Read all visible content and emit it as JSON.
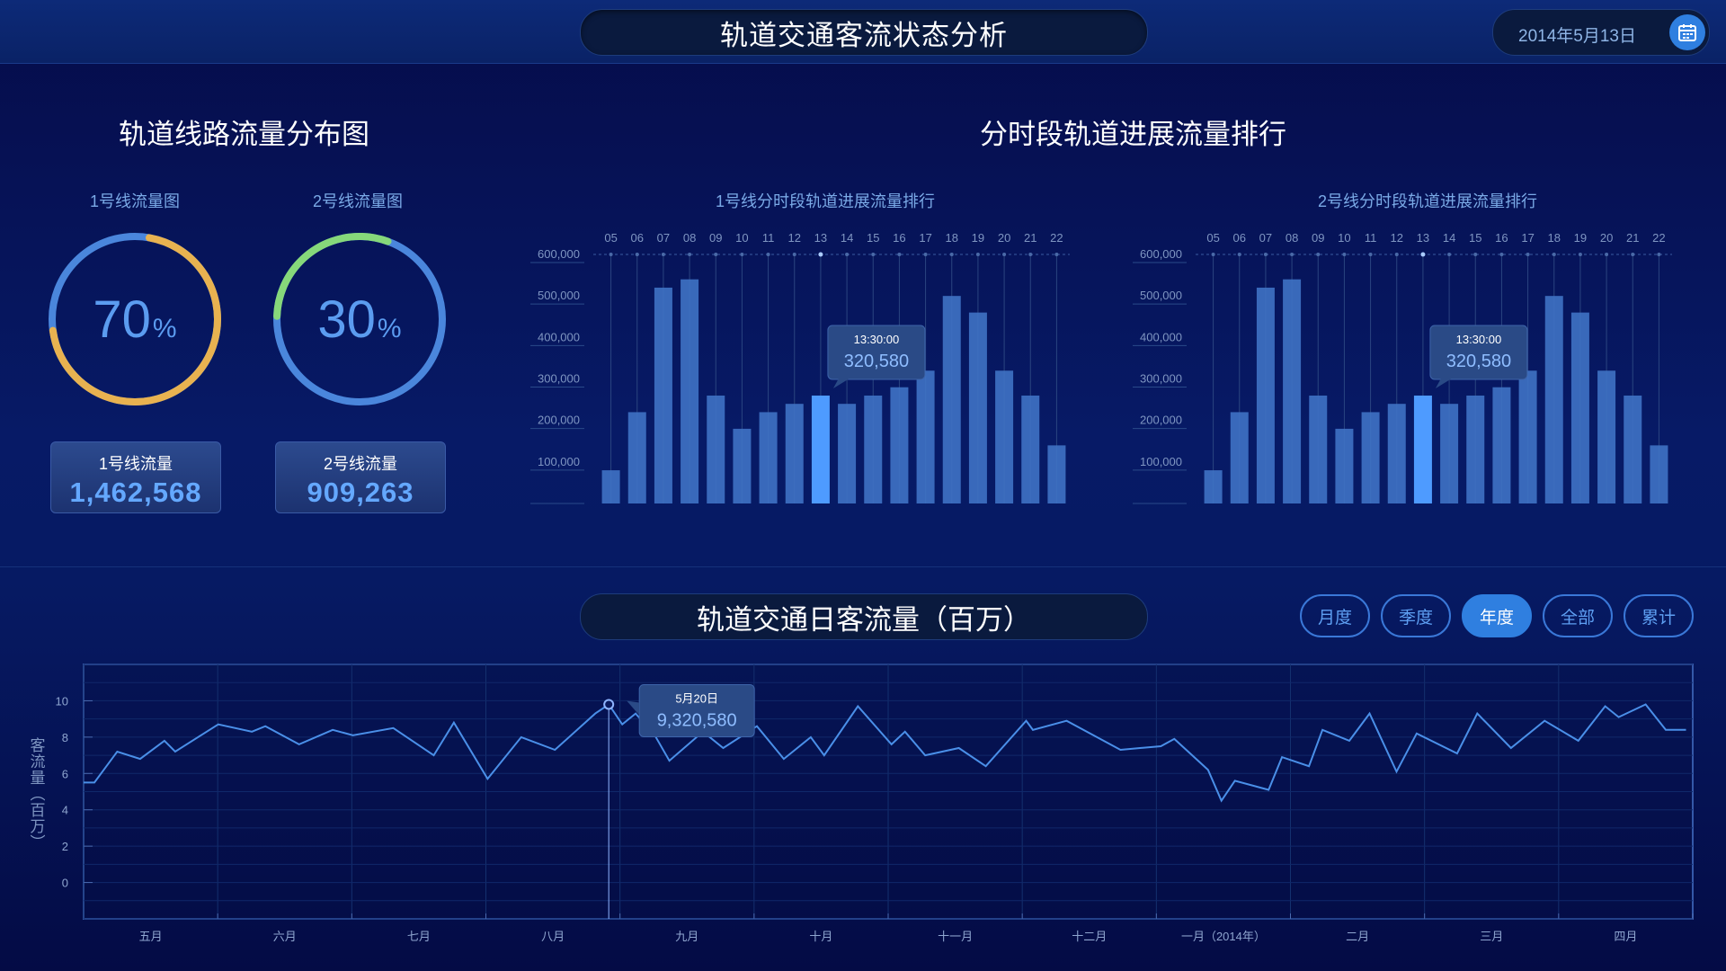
{
  "header": {
    "title": "轨道交通客流状态分析",
    "date": "2014年5月13日"
  },
  "distribution": {
    "title": "轨道线路流量分布图",
    "donuts": [
      {
        "label": "1号线流量图",
        "value": "70",
        "unit": "%",
        "percent": 70,
        "color_main": "#e8b250",
        "color_rest": "#4a86dc"
      },
      {
        "label": "2号线流量图",
        "value": "30",
        "unit": "%",
        "percent": 30,
        "color_main": "#86d87a",
        "color_rest": "#4a86dc"
      }
    ],
    "stats": [
      {
        "label": "1号线流量",
        "value": "1,462,568"
      },
      {
        "label": "2号线流量",
        "value": "909,263"
      }
    ]
  },
  "ranking": {
    "title": "分时段轨道进展流量排行"
  },
  "chart_data": [
    {
      "type": "bar",
      "title": "1号线分时段轨道进展流量排行",
      "categories": [
        "05",
        "06",
        "07",
        "08",
        "09",
        "10",
        "11",
        "12",
        "13",
        "14",
        "15",
        "16",
        "17",
        "18",
        "19",
        "20",
        "21",
        "22"
      ],
      "values": [
        80000,
        220000,
        520000,
        540000,
        260000,
        180000,
        220000,
        240000,
        260000,
        240000,
        260000,
        280000,
        320000,
        500000,
        460000,
        320000,
        260000,
        140000
      ],
      "yticks": [
        "100,000",
        "200,000",
        "300,000",
        "400,000",
        "500,000",
        "600,000"
      ],
      "ylim": [
        0,
        600000
      ],
      "highlight_index": 8,
      "tooltip": {
        "time": "13:30:00",
        "value": "320,580"
      }
    },
    {
      "type": "bar",
      "title": "2号线分时段轨道进展流量排行",
      "categories": [
        "05",
        "06",
        "07",
        "08",
        "09",
        "10",
        "11",
        "12",
        "13",
        "14",
        "15",
        "16",
        "17",
        "18",
        "19",
        "20",
        "21",
        "22"
      ],
      "values": [
        80000,
        220000,
        520000,
        540000,
        260000,
        180000,
        220000,
        240000,
        260000,
        240000,
        260000,
        280000,
        320000,
        500000,
        460000,
        320000,
        260000,
        140000
      ],
      "yticks": [
        "100,000",
        "200,000",
        "300,000",
        "400,000",
        "500,000",
        "600,000"
      ],
      "ylim": [
        0,
        600000
      ],
      "highlight_index": 8,
      "tooltip": {
        "time": "13:30:00",
        "value": "320,580"
      }
    },
    {
      "type": "line",
      "title": "轨道交通日客流量（百万）",
      "ylabel": "客流量（百万）",
      "yticks": [
        "0",
        "2",
        "4",
        "6",
        "8",
        "10"
      ],
      "ylim": [
        -2,
        12
      ],
      "xlabels": [
        "五月",
        "六月",
        "七月",
        "八月",
        "九月",
        "十月",
        "十一月",
        "十二月",
        "一月（2014年）",
        "二月",
        "三月",
        "四月"
      ],
      "x": [
        0,
        0.08,
        0.25,
        0.42,
        0.6,
        0.68,
        1,
        1.25,
        1.35,
        1.6,
        1.85,
        2,
        2.3,
        2.6,
        2.75,
        3,
        3.25,
        3.5,
        3.8,
        3.9,
        4,
        4.1,
        4.25,
        4.35,
        4.6,
        4.75,
        5,
        5.2,
        5.4,
        5.5,
        5.75,
        6,
        6.1,
        6.25,
        6.5,
        6.7,
        7,
        7.05,
        7.3,
        7.7,
        8,
        8.1,
        8.35,
        8.45,
        8.55,
        8.8,
        8.9,
        9.1,
        9.2,
        9.4,
        9.55,
        9.75,
        9.9,
        10.2,
        10.35,
        10.6,
        10.85,
        11.1,
        11.3,
        11.4,
        11.6,
        11.75,
        11.9
      ],
      "y": [
        5.5,
        5.5,
        7.2,
        6.8,
        7.8,
        7.2,
        8.7,
        8.3,
        8.6,
        7.6,
        8.4,
        8.1,
        8.5,
        7.0,
        8.8,
        5.7,
        8.0,
        7.3,
        9.3,
        9.8,
        8.7,
        9.3,
        8.0,
        6.7,
        8.3,
        7.4,
        8.6,
        6.8,
        8.0,
        7.0,
        9.7,
        7.6,
        8.3,
        7.0,
        7.4,
        6.4,
        8.9,
        8.4,
        8.9,
        7.3,
        7.5,
        7.9,
        6.2,
        4.5,
        5.6,
        5.1,
        6.9,
        6.4,
        8.4,
        7.8,
        9.3,
        6.1,
        8.2,
        7.1,
        9.3,
        7.4,
        8.9,
        7.8,
        9.7,
        9.1,
        9.8,
        8.4,
        8.4
      ],
      "marker_index": 19,
      "tooltip": {
        "date": "5月20日",
        "value": "9,320,580"
      }
    }
  ],
  "daily": {
    "title": "轨道交通日客流量（百万）",
    "tabs": [
      {
        "label": "月度",
        "active": false
      },
      {
        "label": "季度",
        "active": false
      },
      {
        "label": "年度",
        "active": true
      },
      {
        "label": "全部",
        "active": false
      },
      {
        "label": "累计",
        "active": false
      }
    ]
  },
  "colors": {
    "accent": "#2f7fe0",
    "bar": "#3f72c4",
    "bar_highlight": "#4e9bff",
    "line": "#4a8fe8"
  }
}
